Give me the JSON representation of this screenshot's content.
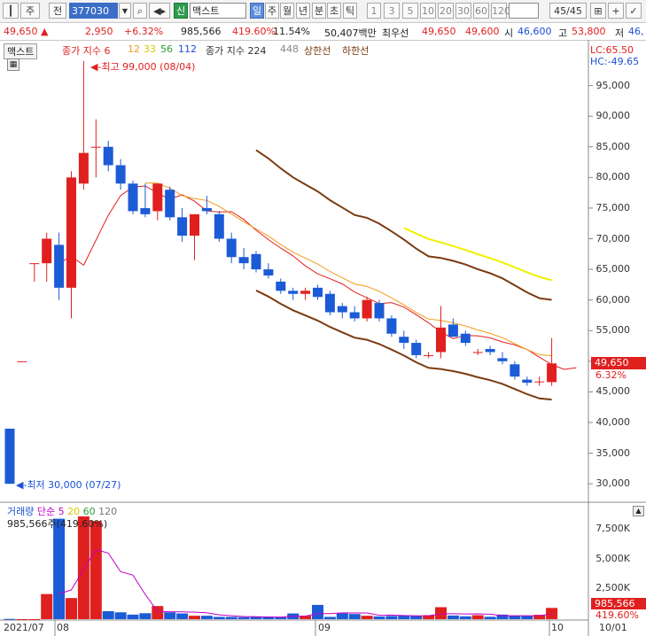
{
  "toolbar": {
    "period_label": "주",
    "prev_label": "전",
    "code": "377030",
    "search_icon": "magnifier-icon",
    "signal_label": "신",
    "stock_name": "맥스트",
    "tabs": [
      "일",
      "주",
      "월",
      "년",
      "분",
      "초",
      "틱"
    ],
    "active_tab": "일",
    "intervals": [
      "1",
      "3",
      "5",
      "10",
      "20",
      "30",
      "60",
      "120"
    ],
    "page_count": "45/45"
  },
  "quote": {
    "price": "49,650",
    "change": "2,950",
    "change_pct": "+6.32%",
    "volume": "985,566",
    "volume_pct": "419.60%",
    "turnover_pct": "11.54%",
    "amount": "50,407백만",
    "best_line_label": "최우선",
    "best_ask": "49,650",
    "best_bid": "49,600",
    "open_label": "시",
    "open": "46,600",
    "high_label": "고",
    "high": "53,800",
    "low_label": "저",
    "low": "46,"
  },
  "legend_top": {
    "tag": "맥스트",
    "ma_label": "종가 지수 6",
    "ma_12": "12",
    "ma_33": "33",
    "ma_56": "56",
    "ma_112": "112",
    "env_label": "종가 지수 224",
    "env_448": "448",
    "limit_up": "상한선",
    "limit_down": "하한선",
    "lc": "LC:65.50",
    "hc": "HC:-49.65"
  },
  "annotations": {
    "high": "최고 99,000 (08/04)",
    "low": "최저 30,000 (07/27)"
  },
  "price_axis": [
    "95,000",
    "90,000",
    "85,000",
    "80,000",
    "75,000",
    "70,000",
    "65,000",
    "60,000",
    "55,000",
    "50,000",
    "45,000",
    "40,000",
    "35,000",
    "30,000"
  ],
  "price_marker": {
    "value": "49,650",
    "pct": "6.32%"
  },
  "volume_legend": {
    "label": "거래량",
    "ma_label": "단순 5",
    "ma_20": "20",
    "ma_60": "60",
    "ma_120": "120",
    "info": "985,566주(419.60%)"
  },
  "volume_axis": [
    "7,500K",
    "5,000K",
    "2,500K"
  ],
  "volume_marker": {
    "value": "985,566",
    "pct": "419.60%"
  },
  "date_axis": [
    "2021/07",
    "08",
    "09",
    "10",
    "10/01"
  ],
  "colors": {
    "up": "#e0201f",
    "down": "#1c5bd6",
    "ma6": "#e0201f",
    "ma12": "#f39a1a",
    "ma33": "#f0f000",
    "env": "#7a3b10",
    "vol_ma": "#c400c4"
  },
  "chart_data": {
    "type": "candlestick",
    "price_range": [
      28000,
      100000
    ],
    "candles": [
      {
        "o": 39000,
        "h": 39000,
        "l": 30000,
        "c": 30000
      },
      {
        "o": 50000,
        "h": 50000,
        "l": 50000,
        "c": 50000
      },
      {
        "o": 66000,
        "h": 66000,
        "l": 63000,
        "c": 66000
      },
      {
        "o": 66000,
        "h": 71000,
        "l": 63000,
        "c": 70000
      },
      {
        "o": 69000,
        "h": 71000,
        "l": 60000,
        "c": 62000
      },
      {
        "o": 62000,
        "h": 81000,
        "l": 57000,
        "c": 80000
      },
      {
        "o": 79000,
        "h": 99000,
        "l": 78000,
        "c": 84000
      },
      {
        "o": 85000,
        "h": 89500,
        "l": 80000,
        "c": 85000
      },
      {
        "o": 85000,
        "h": 86000,
        "l": 81000,
        "c": 82000
      },
      {
        "o": 82000,
        "h": 83000,
        "l": 78000,
        "c": 79000
      },
      {
        "o": 79000,
        "h": 79500,
        "l": 74000,
        "c": 74500
      },
      {
        "o": 75000,
        "h": 79000,
        "l": 73500,
        "c": 74000
      },
      {
        "o": 74500,
        "h": 79000,
        "l": 73000,
        "c": 79000
      },
      {
        "o": 78000,
        "h": 78500,
        "l": 73000,
        "c": 73500
      },
      {
        "o": 73500,
        "h": 75000,
        "l": 69500,
        "c": 70500
      },
      {
        "o": 70500,
        "h": 74000,
        "l": 66500,
        "c": 74000
      },
      {
        "o": 75000,
        "h": 77000,
        "l": 74000,
        "c": 74500
      },
      {
        "o": 74000,
        "h": 74500,
        "l": 69500,
        "c": 70000
      },
      {
        "o": 70000,
        "h": 71000,
        "l": 66000,
        "c": 67000
      },
      {
        "o": 67000,
        "h": 68500,
        "l": 65000,
        "c": 66000
      },
      {
        "o": 67500,
        "h": 68000,
        "l": 64500,
        "c": 65000
      },
      {
        "o": 65000,
        "h": 66000,
        "l": 63500,
        "c": 64000
      },
      {
        "o": 63000,
        "h": 63500,
        "l": 61000,
        "c": 61500
      },
      {
        "o": 61500,
        "h": 62000,
        "l": 60000,
        "c": 61000
      },
      {
        "o": 61000,
        "h": 62000,
        "l": 60000,
        "c": 61500
      },
      {
        "o": 62000,
        "h": 62500,
        "l": 60000,
        "c": 60500
      },
      {
        "o": 61000,
        "h": 61500,
        "l": 57500,
        "c": 58000
      },
      {
        "o": 59000,
        "h": 59500,
        "l": 57000,
        "c": 58000
      },
      {
        "o": 58000,
        "h": 59000,
        "l": 56500,
        "c": 57000
      },
      {
        "o": 57000,
        "h": 60500,
        "l": 56500,
        "c": 60000
      },
      {
        "o": 59500,
        "h": 60000,
        "l": 56500,
        "c": 57000
      },
      {
        "o": 57000,
        "h": 57500,
        "l": 54000,
        "c": 54500
      },
      {
        "o": 54000,
        "h": 55000,
        "l": 52000,
        "c": 53000
      },
      {
        "o": 53000,
        "h": 53500,
        "l": 50500,
        "c": 51000
      },
      {
        "o": 51000,
        "h": 51500,
        "l": 50500,
        "c": 51000
      },
      {
        "o": 51500,
        "h": 59000,
        "l": 50500,
        "c": 55500
      },
      {
        "o": 56000,
        "h": 57000,
        "l": 54000,
        "c": 54000
      },
      {
        "o": 54500,
        "h": 55000,
        "l": 52500,
        "c": 53000
      },
      {
        "o": 51500,
        "h": 52000,
        "l": 51000,
        "c": 51500
      },
      {
        "o": 52000,
        "h": 52500,
        "l": 51000,
        "c": 51500
      },
      {
        "o": 50500,
        "h": 51500,
        "l": 49500,
        "c": 50000
      },
      {
        "o": 49500,
        "h": 50000,
        "l": 47000,
        "c": 47500
      },
      {
        "o": 47000,
        "h": 47500,
        "l": 46000,
        "c": 46500
      },
      {
        "o": 46600,
        "h": 47500,
        "l": 46000,
        "c": 46700
      },
      {
        "o": 46600,
        "h": 53800,
        "l": 46000,
        "c": 49650
      }
    ],
    "volumes": [
      25,
      0,
      0,
      2200,
      8800,
      1850,
      9000,
      8600,
      700,
      600,
      400,
      520,
      1150,
      600,
      500,
      300,
      300,
      200,
      200,
      180,
      200,
      190,
      180,
      500,
      300,
      1250,
      200,
      500,
      450,
      300,
      240,
      280,
      320,
      320,
      350,
      1050,
      320,
      250,
      350,
      210,
      400,
      290,
      270,
      380,
      985.566
    ],
    "volume_range": [
      0,
      9000
    ]
  }
}
